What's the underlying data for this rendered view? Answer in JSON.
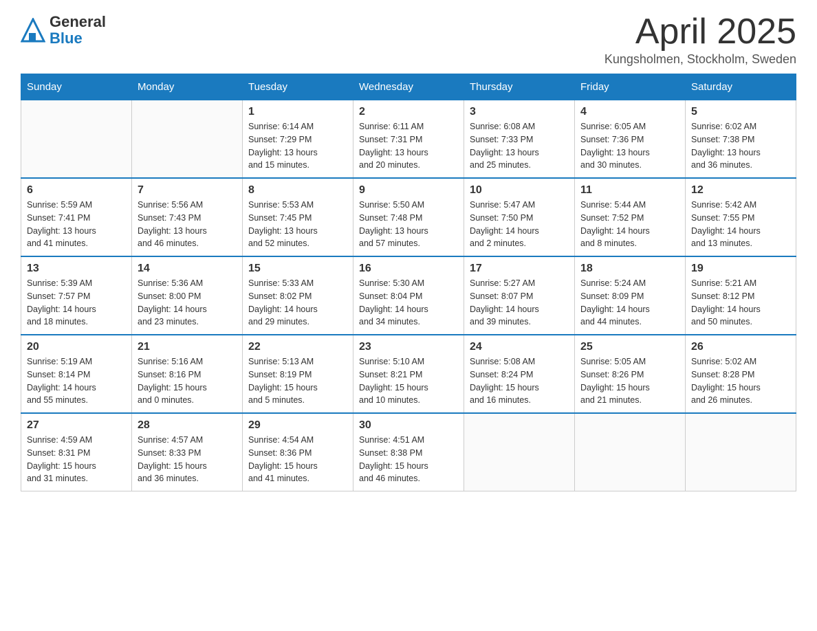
{
  "header": {
    "logo_general": "General",
    "logo_blue": "Blue",
    "month_title": "April 2025",
    "subtitle": "Kungsholmen, Stockholm, Sweden"
  },
  "weekdays": [
    "Sunday",
    "Monday",
    "Tuesday",
    "Wednesday",
    "Thursday",
    "Friday",
    "Saturday"
  ],
  "weeks": [
    [
      {
        "day": "",
        "info": ""
      },
      {
        "day": "",
        "info": ""
      },
      {
        "day": "1",
        "info": "Sunrise: 6:14 AM\nSunset: 7:29 PM\nDaylight: 13 hours\nand 15 minutes."
      },
      {
        "day": "2",
        "info": "Sunrise: 6:11 AM\nSunset: 7:31 PM\nDaylight: 13 hours\nand 20 minutes."
      },
      {
        "day": "3",
        "info": "Sunrise: 6:08 AM\nSunset: 7:33 PM\nDaylight: 13 hours\nand 25 minutes."
      },
      {
        "day": "4",
        "info": "Sunrise: 6:05 AM\nSunset: 7:36 PM\nDaylight: 13 hours\nand 30 minutes."
      },
      {
        "day": "5",
        "info": "Sunrise: 6:02 AM\nSunset: 7:38 PM\nDaylight: 13 hours\nand 36 minutes."
      }
    ],
    [
      {
        "day": "6",
        "info": "Sunrise: 5:59 AM\nSunset: 7:41 PM\nDaylight: 13 hours\nand 41 minutes."
      },
      {
        "day": "7",
        "info": "Sunrise: 5:56 AM\nSunset: 7:43 PM\nDaylight: 13 hours\nand 46 minutes."
      },
      {
        "day": "8",
        "info": "Sunrise: 5:53 AM\nSunset: 7:45 PM\nDaylight: 13 hours\nand 52 minutes."
      },
      {
        "day": "9",
        "info": "Sunrise: 5:50 AM\nSunset: 7:48 PM\nDaylight: 13 hours\nand 57 minutes."
      },
      {
        "day": "10",
        "info": "Sunrise: 5:47 AM\nSunset: 7:50 PM\nDaylight: 14 hours\nand 2 minutes."
      },
      {
        "day": "11",
        "info": "Sunrise: 5:44 AM\nSunset: 7:52 PM\nDaylight: 14 hours\nand 8 minutes."
      },
      {
        "day": "12",
        "info": "Sunrise: 5:42 AM\nSunset: 7:55 PM\nDaylight: 14 hours\nand 13 minutes."
      }
    ],
    [
      {
        "day": "13",
        "info": "Sunrise: 5:39 AM\nSunset: 7:57 PM\nDaylight: 14 hours\nand 18 minutes."
      },
      {
        "day": "14",
        "info": "Sunrise: 5:36 AM\nSunset: 8:00 PM\nDaylight: 14 hours\nand 23 minutes."
      },
      {
        "day": "15",
        "info": "Sunrise: 5:33 AM\nSunset: 8:02 PM\nDaylight: 14 hours\nand 29 minutes."
      },
      {
        "day": "16",
        "info": "Sunrise: 5:30 AM\nSunset: 8:04 PM\nDaylight: 14 hours\nand 34 minutes."
      },
      {
        "day": "17",
        "info": "Sunrise: 5:27 AM\nSunset: 8:07 PM\nDaylight: 14 hours\nand 39 minutes."
      },
      {
        "day": "18",
        "info": "Sunrise: 5:24 AM\nSunset: 8:09 PM\nDaylight: 14 hours\nand 44 minutes."
      },
      {
        "day": "19",
        "info": "Sunrise: 5:21 AM\nSunset: 8:12 PM\nDaylight: 14 hours\nand 50 minutes."
      }
    ],
    [
      {
        "day": "20",
        "info": "Sunrise: 5:19 AM\nSunset: 8:14 PM\nDaylight: 14 hours\nand 55 minutes."
      },
      {
        "day": "21",
        "info": "Sunrise: 5:16 AM\nSunset: 8:16 PM\nDaylight: 15 hours\nand 0 minutes."
      },
      {
        "day": "22",
        "info": "Sunrise: 5:13 AM\nSunset: 8:19 PM\nDaylight: 15 hours\nand 5 minutes."
      },
      {
        "day": "23",
        "info": "Sunrise: 5:10 AM\nSunset: 8:21 PM\nDaylight: 15 hours\nand 10 minutes."
      },
      {
        "day": "24",
        "info": "Sunrise: 5:08 AM\nSunset: 8:24 PM\nDaylight: 15 hours\nand 16 minutes."
      },
      {
        "day": "25",
        "info": "Sunrise: 5:05 AM\nSunset: 8:26 PM\nDaylight: 15 hours\nand 21 minutes."
      },
      {
        "day": "26",
        "info": "Sunrise: 5:02 AM\nSunset: 8:28 PM\nDaylight: 15 hours\nand 26 minutes."
      }
    ],
    [
      {
        "day": "27",
        "info": "Sunrise: 4:59 AM\nSunset: 8:31 PM\nDaylight: 15 hours\nand 31 minutes."
      },
      {
        "day": "28",
        "info": "Sunrise: 4:57 AM\nSunset: 8:33 PM\nDaylight: 15 hours\nand 36 minutes."
      },
      {
        "day": "29",
        "info": "Sunrise: 4:54 AM\nSunset: 8:36 PM\nDaylight: 15 hours\nand 41 minutes."
      },
      {
        "day": "30",
        "info": "Sunrise: 4:51 AM\nSunset: 8:38 PM\nDaylight: 15 hours\nand 46 minutes."
      },
      {
        "day": "",
        "info": ""
      },
      {
        "day": "",
        "info": ""
      },
      {
        "day": "",
        "info": ""
      }
    ]
  ]
}
